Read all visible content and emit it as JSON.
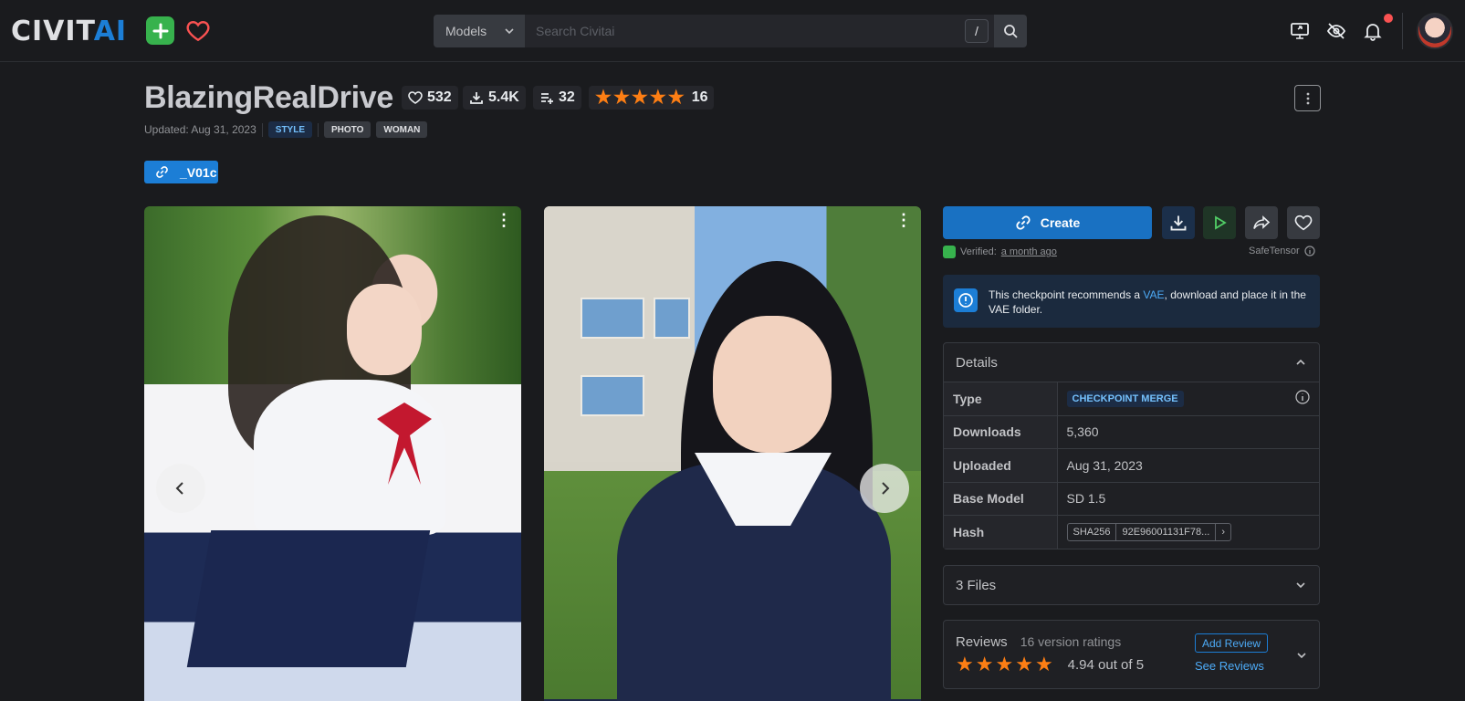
{
  "header": {
    "logo_main": "CIVIT",
    "logo_accent": "AI",
    "search": {
      "category": "Models",
      "placeholder": "Search Civitai",
      "shortcut": "/"
    },
    "icons": [
      "add-icon",
      "heart-icon",
      "search-icon",
      "screen-share-icon",
      "eye-off-icon",
      "bell-icon"
    ]
  },
  "model": {
    "title": "BlazingRealDrive",
    "stats": {
      "likes": "532",
      "downloads": "5.4K",
      "collected": "32",
      "rating_count": "16"
    },
    "rating_stars": 5,
    "updated": "Updated: Aug 31, 2023",
    "tags": [
      "STYLE",
      "PHOTO",
      "WOMAN"
    ],
    "version": "_V01c"
  },
  "actions": {
    "create_label": "Create",
    "verified_label": "Verified:",
    "verified_time": "a month ago",
    "format": "SafeTensor"
  },
  "alert": {
    "text_before": "This checkpoint recommends a ",
    "link": "VAE",
    "text_after": ", download and place it in the VAE folder."
  },
  "details": {
    "title": "Details",
    "rows": [
      {
        "key": "Type",
        "value": "CHECKPOINT MERGE"
      },
      {
        "key": "Downloads",
        "value": "5,360"
      },
      {
        "key": "Uploaded",
        "value": "Aug 31, 2023"
      },
      {
        "key": "Base Model",
        "value": "SD 1.5"
      },
      {
        "key": "Hash",
        "hash_type": "SHA256",
        "value": "92E96001131F78..."
      }
    ]
  },
  "files": {
    "title": "3 Files"
  },
  "reviews": {
    "title": "Reviews",
    "count_label": "16 version ratings",
    "score_label": "4.94 out of 5",
    "stars": 5,
    "add_label": "Add Review",
    "see_label": "See Reviews"
  },
  "colors": {
    "accent": "#1c7ed6",
    "star": "#fd7e14",
    "green": "#37b24d",
    "background": "#1a1b1e"
  }
}
